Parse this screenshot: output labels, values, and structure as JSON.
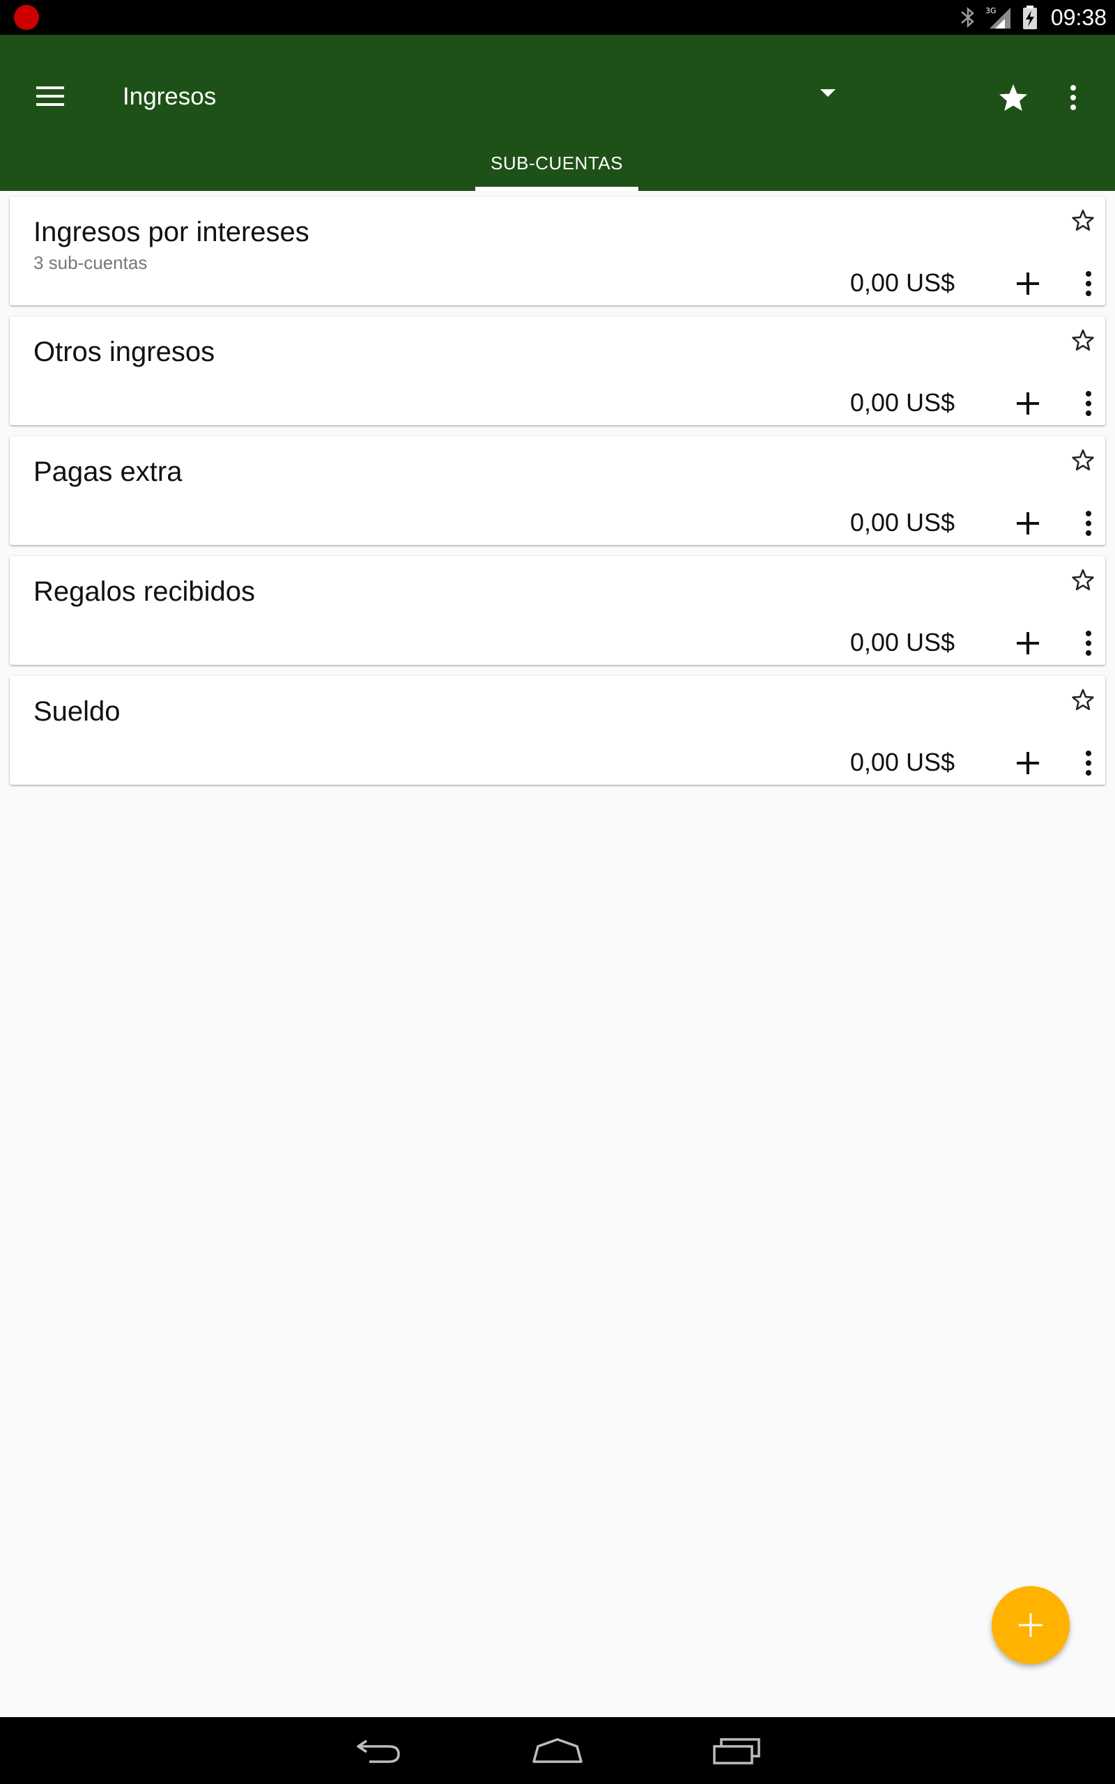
{
  "status_bar": {
    "time": "09:38",
    "network_label": "3G",
    "icons": [
      "recording-dot",
      "bluetooth-icon",
      "signal-icon",
      "battery-charging-icon"
    ]
  },
  "app_bar": {
    "title": "Ingresos",
    "background_color": "#1e5117",
    "icons": [
      "menu-icon",
      "dropdown-arrow-icon",
      "star-filled-icon",
      "more-vert-icon"
    ]
  },
  "tabs": [
    {
      "label": "SUB-CUENTAS",
      "selected": true
    }
  ],
  "accounts": [
    {
      "name": "Ingresos por intereses",
      "subtitle": "3 sub-cuentas",
      "balance": "0,00 US$"
    },
    {
      "name": "Otros ingresos",
      "subtitle": "",
      "balance": "0,00 US$"
    },
    {
      "name": "Pagas extra",
      "subtitle": "",
      "balance": "0,00 US$"
    },
    {
      "name": "Regalos recibidos",
      "subtitle": "",
      "balance": "0,00 US$"
    },
    {
      "name": "Sueldo",
      "subtitle": "",
      "balance": "0,00 US$"
    }
  ],
  "fab": {
    "icon": "plus-icon",
    "color": "#ffb300"
  },
  "nav_bar": {
    "icons": [
      "back-icon",
      "home-icon",
      "recents-icon"
    ]
  }
}
